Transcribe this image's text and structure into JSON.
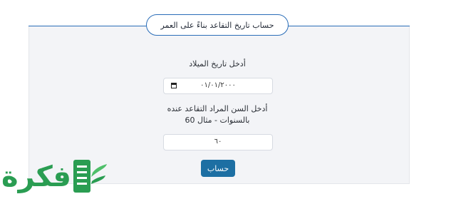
{
  "title": "حساب تاريخ التقاعد بناءً على العمر",
  "birthdate": {
    "label": "أدخل تاريخ الميلاد",
    "value": "٠١/٠١/٢٠٠٠"
  },
  "retirement_age": {
    "label_line1": "أدخل السن المراد التقاعد عنده",
    "label_line2": "بالسنوات - مثال 60",
    "value": "٦٠"
  },
  "calculate_label": "حساب",
  "logo": {
    "text": "فكرة",
    "color": "#2a9d52"
  },
  "colors": {
    "accent": "#2a6db8",
    "button": "#1d6fa3",
    "panel": "#f3f4f7"
  }
}
